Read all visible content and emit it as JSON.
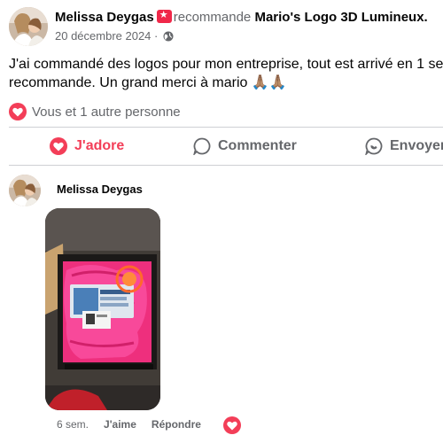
{
  "post": {
    "author": "Melissa Deygas",
    "verb": "recommande",
    "page": "Mario's Logo 3D Lumineux.",
    "date": "20 décembre 2024 ·",
    "text_line1": "J'ai commandé des logos pour mon entreprise, tout est arrivé en 1 se",
    "text_line2": "recommande. Un grand merci à mario 🙏🏽🙏🏽",
    "reactions_text": "Vous et 1 autre personne",
    "icons": {
      "recommend": "recommend-star-badge-icon",
      "privacy": "globe-icon",
      "reaction": "heart-icon"
    }
  },
  "actions": {
    "adore": "J'adore",
    "comment": "Commenter",
    "share": "Envoyer"
  },
  "comment": {
    "author": "Melissa Deygas",
    "time": "6 sem.",
    "like": "J'aime",
    "reply": "Répondre"
  },
  "colors": {
    "accent_red": "#f33e58",
    "secondary_text": "#65676b",
    "divider": "#ced0d4"
  }
}
